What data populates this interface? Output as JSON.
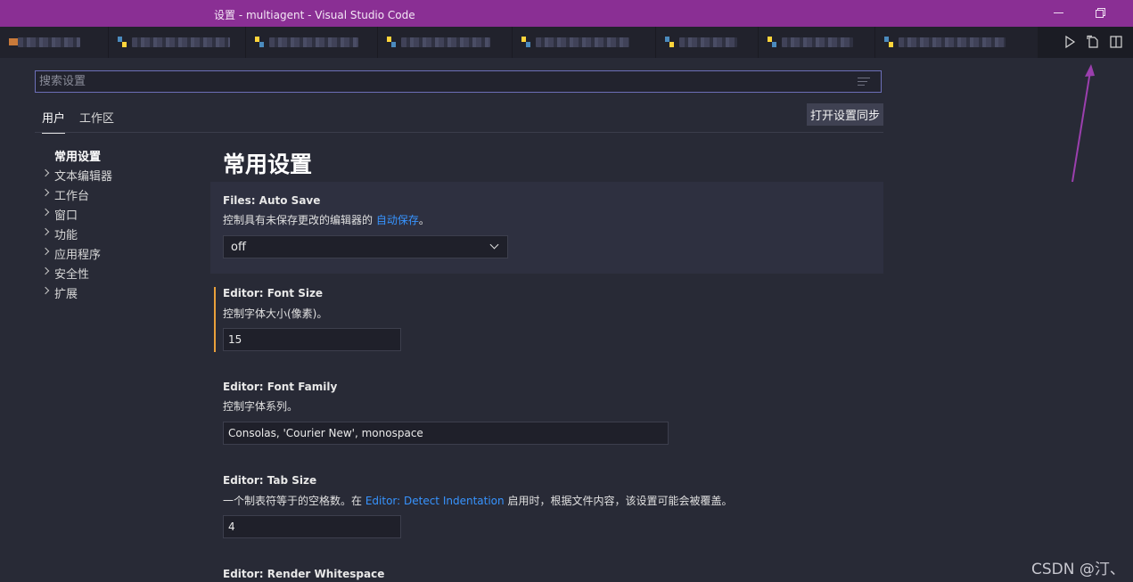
{
  "window": {
    "title": "设置 - multiagent - Visual Studio Code"
  },
  "colors": {
    "titlebar": "#8a2f94",
    "background": "#282a36",
    "accent_link": "#3794ff",
    "modified_indicator": "#e9a03b",
    "annotation_arrow": "#9b3fae"
  },
  "tabs": [
    {
      "icon": "file-icon-orange"
    },
    {
      "icon": "python-file-icon"
    },
    {
      "icon": "python-file-icon"
    },
    {
      "icon": "python-file-icon"
    },
    {
      "icon": "python-file-icon"
    },
    {
      "icon": "python-file-icon"
    },
    {
      "icon": "python-file-icon"
    },
    {
      "icon": "python-file-icon"
    }
  ],
  "editor_actions": [
    "run-icon",
    "open-settings-json-icon",
    "split-editor-icon"
  ],
  "settings": {
    "search": {
      "placeholder": "搜索设置",
      "value": ""
    },
    "scopes": [
      {
        "label": "用户",
        "active": true
      },
      {
        "label": "工作区",
        "active": false
      }
    ],
    "sync_button": "打开设置同步",
    "toc": [
      {
        "label": "常用设置",
        "expandable": false,
        "active": true
      },
      {
        "label": "文本编辑器",
        "expandable": true
      },
      {
        "label": "工作台",
        "expandable": true
      },
      {
        "label": "窗口",
        "expandable": true
      },
      {
        "label": "功能",
        "expandable": true
      },
      {
        "label": "应用程序",
        "expandable": true
      },
      {
        "label": "安全性",
        "expandable": true
      },
      {
        "label": "扩展",
        "expandable": true
      }
    ],
    "section_title": "常用设置",
    "items": [
      {
        "name": "Files: Auto Save",
        "desc_before": "控制具有未保存更改的编辑器的 ",
        "desc_link": "自动保存",
        "desc_after": "。",
        "type": "select",
        "value": "off"
      },
      {
        "name": "Editor: Font Size",
        "desc": "控制字体大小(像素)。",
        "type": "number",
        "value": "15",
        "modified": true
      },
      {
        "name": "Editor: Font Family",
        "desc": "控制字体系列。",
        "type": "text",
        "value": "Consolas, 'Courier New', monospace"
      },
      {
        "name": "Editor: Tab Size",
        "desc_before": "一个制表符等于的空格数。在 ",
        "desc_link": "Editor: Detect Indentation",
        "desc_after": " 启用时，根据文件内容，该设置可能会被覆盖。",
        "type": "number",
        "value": "4"
      },
      {
        "name": "Editor: Render Whitespace"
      }
    ]
  },
  "watermark": "CSDN @汀、"
}
